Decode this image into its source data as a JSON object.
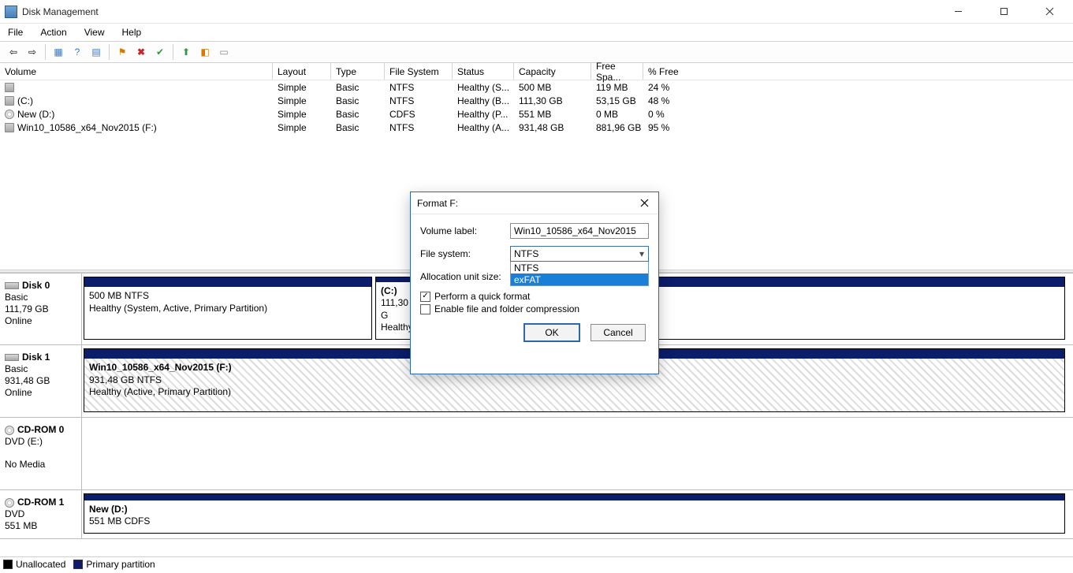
{
  "window": {
    "title": "Disk Management"
  },
  "menu": {
    "file": "File",
    "action": "Action",
    "view": "View",
    "help": "Help"
  },
  "columns": {
    "volume": "Volume",
    "layout": "Layout",
    "type": "Type",
    "fs": "File System",
    "status": "Status",
    "capacity": "Capacity",
    "free": "Free Spa...",
    "pct": "% Free"
  },
  "vols": [
    {
      "name": "",
      "icon": "drive",
      "layout": "Simple",
      "type": "Basic",
      "fs": "NTFS",
      "status": "Healthy (S...",
      "cap": "500 MB",
      "free": "119 MB",
      "pct": "24 %"
    },
    {
      "name": "(C:)",
      "icon": "drive",
      "layout": "Simple",
      "type": "Basic",
      "fs": "NTFS",
      "status": "Healthy (B...",
      "cap": "111,30 GB",
      "free": "53,15 GB",
      "pct": "48 %"
    },
    {
      "name": "New (D:)",
      "icon": "cd",
      "layout": "Simple",
      "type": "Basic",
      "fs": "CDFS",
      "status": "Healthy (P...",
      "cap": "551 MB",
      "free": "0 MB",
      "pct": "0 %"
    },
    {
      "name": "Win10_10586_x64_Nov2015 (F:)",
      "icon": "drive",
      "layout": "Simple",
      "type": "Basic",
      "fs": "NTFS",
      "status": "Healthy (A...",
      "cap": "931,48 GB",
      "free": "881,96 GB",
      "pct": "95 %"
    }
  ],
  "disks": {
    "d0": {
      "name": "Disk 0",
      "type": "Basic",
      "size": "111,79 GB",
      "status": "Online",
      "p0": {
        "title": "",
        "line1": "500 MB NTFS",
        "line2": "Healthy (System, Active, Primary Partition)"
      },
      "p1": {
        "title": "(C:)",
        "line1": "111,30 G",
        "line2": "Healthy"
      }
    },
    "d1": {
      "name": "Disk 1",
      "type": "Basic",
      "size": "931,48 GB",
      "status": "Online",
      "p0": {
        "title": "Win10_10586_x64_Nov2015  (F:)",
        "line1": "931,48 GB NTFS",
        "line2": "Healthy (Active, Primary Partition)"
      }
    },
    "cd0": {
      "name": "CD-ROM 0",
      "type": "DVD (E:)",
      "nomedia": "No Media"
    },
    "cd1": {
      "name": "CD-ROM 1",
      "type": "DVD",
      "size": "551 MB",
      "p0": {
        "title": "New  (D:)",
        "line1": "551 MB CDFS"
      }
    }
  },
  "legend": {
    "unalloc": "Unallocated",
    "primary": "Primary partition"
  },
  "dialog": {
    "title": "Format F:",
    "labels": {
      "vol": "Volume label:",
      "fs": "File system:",
      "au": "Allocation unit size:"
    },
    "vol_value": "Win10_10586_x64_Nov2015",
    "fs_value": "NTFS",
    "fs_opts": {
      "a": "NTFS",
      "b": "exFAT"
    },
    "chk_quick": "Perform a quick format",
    "chk_compress": "Enable file and folder compression",
    "ok": "OK",
    "cancel": "Cancel"
  }
}
